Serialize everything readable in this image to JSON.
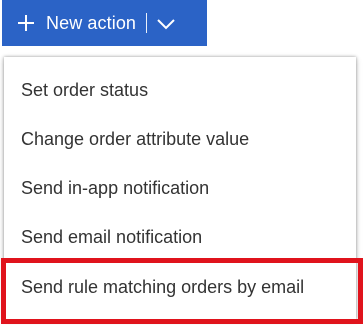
{
  "toolbar": {
    "new_action_label": "New action",
    "plus_icon": "plus-icon",
    "dropdown_icon": "chevron-down-icon",
    "button_color": "#2b63c6"
  },
  "menu": {
    "items": [
      {
        "label": "Set order status"
      },
      {
        "label": "Change order attribute value"
      },
      {
        "label": "Send in-app notification"
      },
      {
        "label": "Send email notification"
      },
      {
        "label": "Send rule matching orders by email",
        "highlighted": true
      }
    ],
    "highlight_color": "#e0131c"
  }
}
